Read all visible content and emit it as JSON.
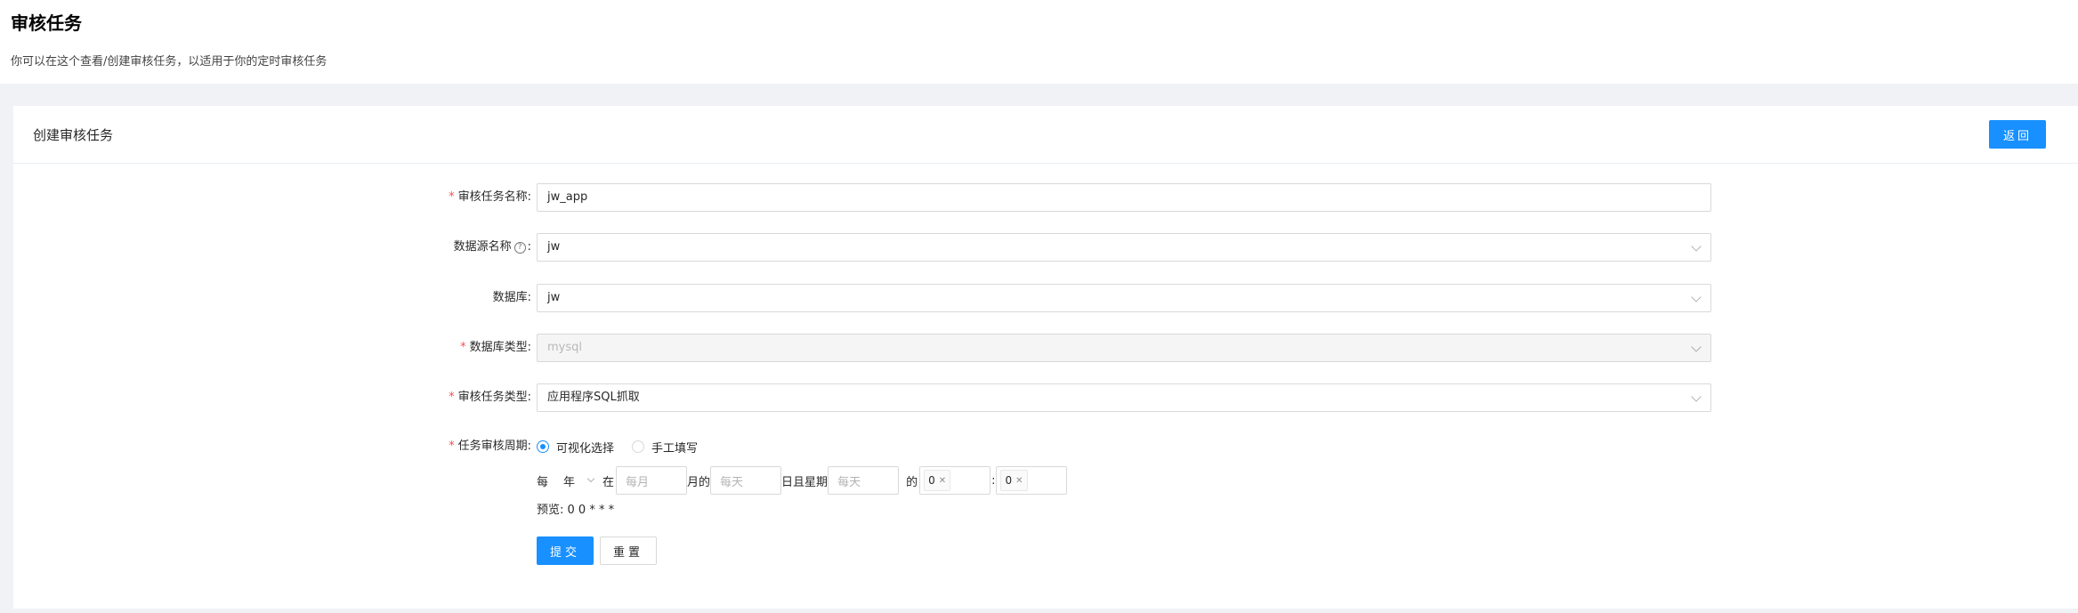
{
  "page": {
    "title": "审核任务",
    "description": "你可以在这个查看/创建审核任务，以适用于你的定时审核任务"
  },
  "card": {
    "title": "创建审核任务",
    "back_label": "返回"
  },
  "form": {
    "task_name": {
      "label": "审核任务名称:",
      "required": true,
      "value": "jw_app"
    },
    "datasource": {
      "label": "数据源名称",
      "suffix": ":",
      "required": false,
      "value": "jw",
      "help_icon": "question-circle-icon"
    },
    "database": {
      "label": "数据库:",
      "required": false,
      "value": "jw"
    },
    "db_type": {
      "label": "数据库类型:",
      "required": true,
      "value": "mysql",
      "disabled": true
    },
    "task_type": {
      "label": "审核任务类型:",
      "required": true,
      "value": "应用程序SQL抓取"
    },
    "cycle": {
      "label": "任务审核周期:",
      "required": true,
      "options": [
        "可视化选择",
        "手工填写"
      ],
      "selected": "可视化选择"
    },
    "cron": {
      "every": "每",
      "unit": "年",
      "at": "在",
      "month_placeholder": "每月",
      "month_suffix": "月的",
      "day_placeholder": "每天",
      "day_suffix": "日且星期",
      "weekday_placeholder": "每天",
      "weekday_suffix": "的",
      "hour_tag": "0",
      "colon": ":",
      "minute_tag": "0"
    },
    "preview": "预览: 0 0 * * *",
    "submit_label": "提交",
    "reset_label": "重置"
  },
  "colors": {
    "primary": "#1890ff",
    "required": "#ff4d4f",
    "background": "#f0f2f5"
  }
}
